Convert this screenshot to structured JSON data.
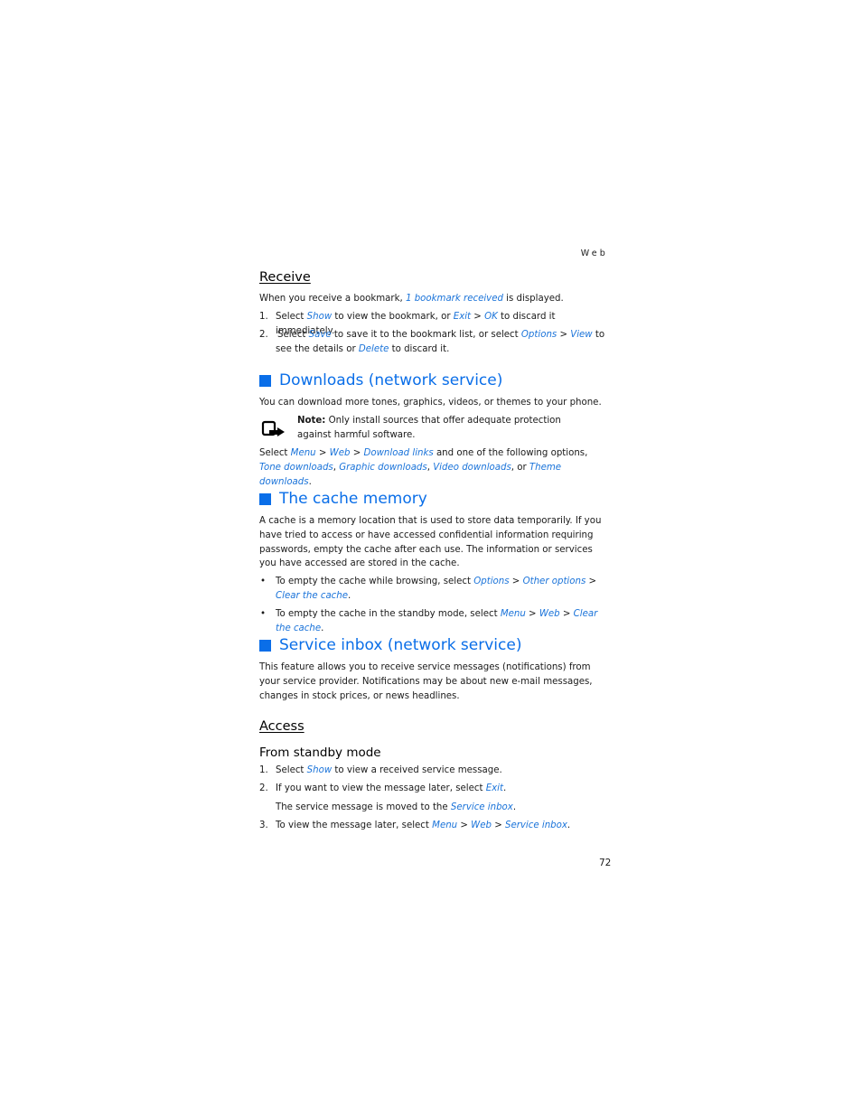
{
  "running_head": "Web",
  "page_number": "72",
  "colors": {
    "heading_blue": "#0a6ee8",
    "link_blue": "#1a73d9"
  },
  "receive": {
    "heading": "Receive",
    "intro": [
      "When you receive a bookmark, ",
      "1 bookmark received",
      " is displayed."
    ],
    "steps": [
      {
        "num": "1.",
        "parts": [
          "Select ",
          "Show",
          " to view the bookmark, or ",
          "Exit",
          " > ",
          "OK",
          " to discard it immediately."
        ]
      },
      {
        "num": "2.",
        "parts": [
          "Select ",
          "Save",
          " to save it to the bookmark list, or select ",
          "Options",
          " > ",
          "View",
          " to see the details or ",
          "Delete",
          " to discard it."
        ]
      }
    ]
  },
  "downloads": {
    "heading": "Downloads (network service)",
    "intro": "You can download more tones, graphics, videos, or themes to your phone.",
    "note_label": "Note:",
    "note_text": " Only install sources that offer adequate protection against harmful software.",
    "note_icon": "note-hand-icon",
    "select": [
      "Select ",
      "Menu",
      " > ",
      "Web",
      " > ",
      "Download links",
      " and one of the following options, ",
      "Tone downloads",
      ", ",
      "Graphic downloads",
      ", ",
      "Video downloads",
      ", or ",
      "Theme downloads",
      "."
    ]
  },
  "cache": {
    "heading": "The cache memory",
    "intro": "A cache is a memory location that is used to store data temporarily. If you have tried to access or have accessed confidential information requiring passwords, empty the cache after each use. The information or services you have accessed are stored in the cache.",
    "bullets": [
      {
        "parts": [
          "To empty the cache while browsing, select ",
          "Options",
          " > ",
          "Other options",
          " > ",
          "Clear the cache",
          "."
        ]
      },
      {
        "parts": [
          "To empty the cache in the standby mode, select ",
          "Menu",
          " > ",
          "Web",
          " > ",
          "Clear the cache",
          "."
        ]
      }
    ]
  },
  "service_inbox": {
    "heading": "Service inbox (network service)",
    "intro": "This feature allows you to receive service messages (notifications) from your service provider. Notifications may be about new e-mail messages, changes in stock prices, or news headlines.",
    "access_heading": "Access",
    "standby_heading": "From standby mode",
    "steps": [
      {
        "num": "1.",
        "parts": [
          "Select ",
          "Show",
          " to view a received service message."
        ]
      },
      {
        "num": "2.",
        "parts": [
          "If you want to view the message later, select ",
          "Exit",
          "."
        ]
      },
      {
        "num": "",
        "parts": [
          "The service message is moved to the ",
          "Service inbox",
          "."
        ]
      },
      {
        "num": "3.",
        "parts": [
          "To view the message later, select ",
          "Menu",
          " > ",
          "Web",
          " > ",
          "Service inbox",
          "."
        ]
      }
    ]
  }
}
